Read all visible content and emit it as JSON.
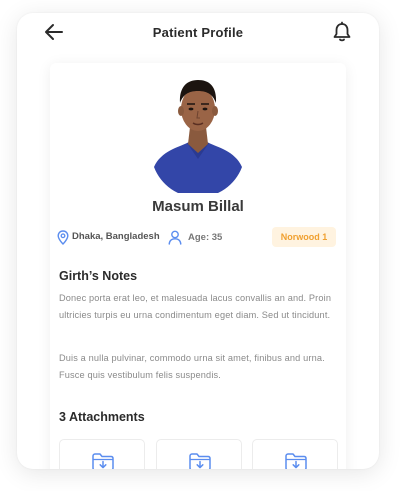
{
  "header": {
    "title": "Patient Profile",
    "back_icon": "arrow-left-icon",
    "notification_icon": "bell-icon"
  },
  "profile": {
    "name": "Masum Billal",
    "avatar_icon": "user-photo",
    "location": "Dhaka, Bangladesh",
    "age_label": "Age: 35",
    "badge": "Norwood 1",
    "colors": {
      "accent_blue": "#5b8def",
      "badge_bg": "#fff3e0",
      "badge_text": "#f0a030"
    }
  },
  "notes": {
    "title": "Girth’s Notes",
    "paragraphs": [
      "Donec porta erat leo, et malesuada lacus convallis an and. Proin ultricies turpis eu urna  condimentum  eget diam. Sed ut tincidunt.",
      "Duis a nulla pulvinar, commodo urna sit amet, finibus and urna. Fusce quis vestibulum felis suspendis."
    ]
  },
  "attachments": {
    "title": "3 Attachments",
    "items": [
      {
        "icon": "folder-download-icon"
      },
      {
        "icon": "folder-download-icon"
      },
      {
        "icon": "folder-download-icon"
      }
    ]
  }
}
